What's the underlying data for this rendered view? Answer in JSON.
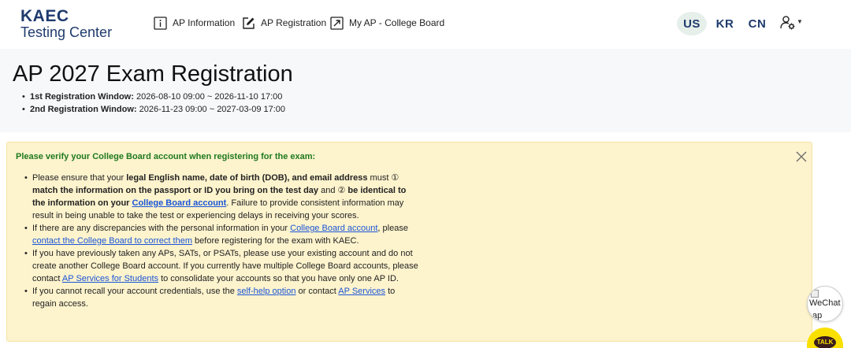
{
  "brand": {
    "line1": "KAEC",
    "line2": "Testing Center"
  },
  "nav": {
    "links": [
      {
        "label": "AP Information",
        "icon": "info-icon"
      },
      {
        "label": "AP Registration",
        "icon": "edit-icon"
      },
      {
        "label": "My AP - College Board",
        "icon": "external-link-icon"
      }
    ],
    "languages": [
      {
        "code": "US",
        "active": true
      },
      {
        "code": "KR",
        "active": false
      },
      {
        "code": "CN",
        "active": false
      }
    ],
    "user_icon": "user-settings-icon"
  },
  "page": {
    "title": "AP 2027 Exam Registration",
    "windows": [
      {
        "label": "1st Registration Window:",
        "value": " 2026-08-10 09:00 ~ 2026-11-10 17:00"
      },
      {
        "label": "2nd Registration Window:",
        "value": " 2026-11-23 09:00 ~ 2027-03-09 17:00"
      }
    ]
  },
  "alert": {
    "title": "Please verify your College Board account when registering for the exam:",
    "items": {
      "i1": {
        "t1": "Please ensure that your ",
        "b1": "legal English name, date of birth (DOB), and email address",
        "t2": " must ① ",
        "b2": "match the information on the passport or ID you bring on the test day",
        "t3": " and ② ",
        "b3": "be identical to the information on your ",
        "link": "College Board account",
        "t4": ". Failure to provide consistent information may result in being unable to take the test or experiencing delays in receiving your scores."
      },
      "i2": {
        "t1": "If there are any discrepancies with the personal information in your ",
        "link1": "College Board account",
        "t2": ", please ",
        "link2": "contact the College Board to correct them",
        "t3": " before registering for the exam with KAEC."
      },
      "i3": {
        "t1": "If you have previously taken any APs, SATs, or PSATs, please use your existing account and do not create another College Board account. If you currently have multiple College Board accounts, please contact ",
        "link": "AP Services for Students",
        "t2": " to consolidate your accounts so that you have only one AP ID."
      },
      "i4": {
        "t1": "If you cannot recall your account credentials, use the ",
        "link1": "self-help option",
        "t2": " or contact ",
        "link2": "AP Services",
        "t3": " to regain access."
      }
    }
  },
  "floating": {
    "wechat_label": "WeChat",
    "wechat_label2": "ap",
    "talk_label": "TALK"
  },
  "colors": {
    "brand": "#1f3b6e",
    "alert_bg": "#fdf3cd",
    "alert_title": "#1f7a1f",
    "link": "#1a55d6",
    "kakao": "#f9e000"
  }
}
